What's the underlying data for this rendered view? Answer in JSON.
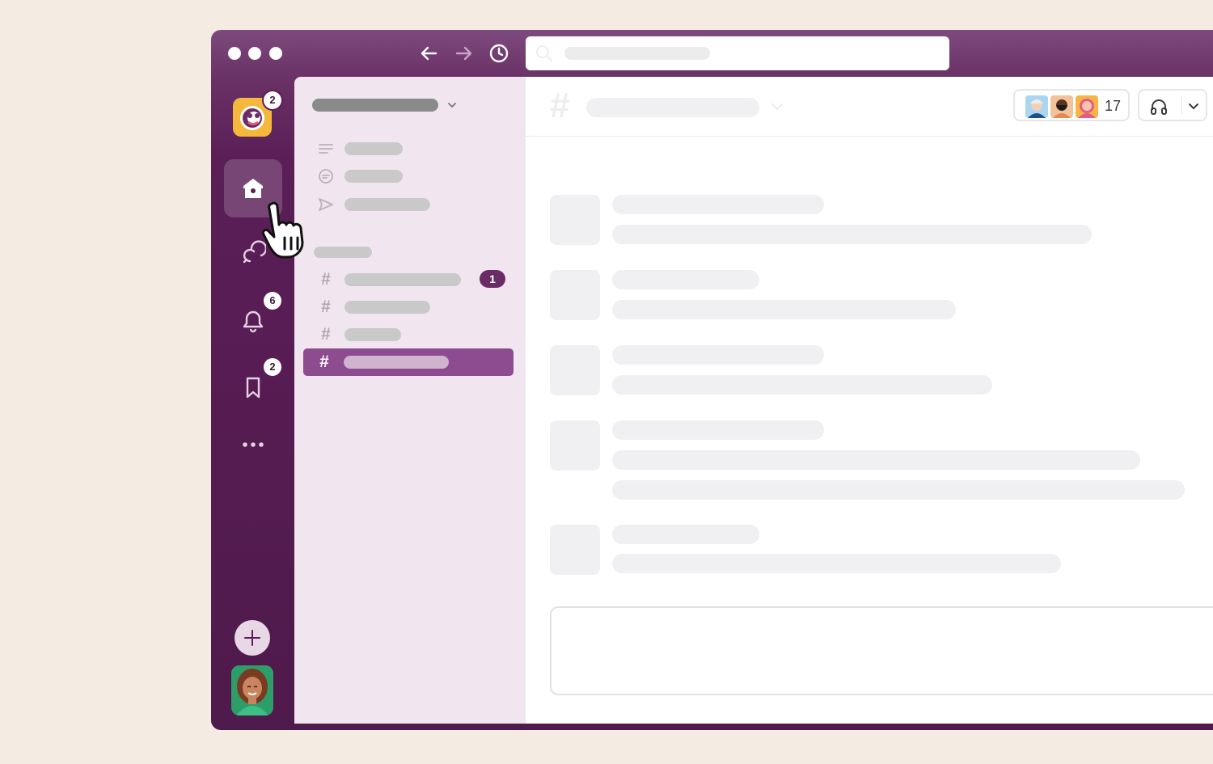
{
  "window": {
    "traffic_lights": [
      "close",
      "minimize",
      "maximize"
    ],
    "nav": [
      "arrow-left-icon",
      "arrow-right-icon",
      "history-icon"
    ],
    "search": {
      "placeholder": ""
    }
  },
  "rail": {
    "workspace": {
      "icon": "workspace-logo-icon",
      "badge": "2"
    },
    "items": [
      {
        "id": "home",
        "icon": "home-icon",
        "active": true,
        "badge": ""
      },
      {
        "id": "dms",
        "icon": "chat-bubbles-icon",
        "active": false,
        "badge": ""
      },
      {
        "id": "activity",
        "icon": "bell-icon",
        "active": false,
        "badge": "6"
      },
      {
        "id": "later",
        "icon": "bookmark-icon",
        "active": false,
        "badge": "2"
      },
      {
        "id": "more",
        "icon": "more-dots-icon",
        "active": false,
        "badge": ""
      }
    ],
    "add_button": "plus-icon",
    "user_avatar": "user-avatar"
  },
  "sidebar": {
    "channels": [
      {
        "unread": "1"
      },
      {
        "unread": ""
      },
      {
        "unread": ""
      },
      {
        "unread": "",
        "selected": true
      }
    ]
  },
  "main": {
    "header": {
      "hash_icon": "#",
      "member_count": "17",
      "huddle_icon": "headphones-icon"
    }
  },
  "colors": {
    "background": "#f4ece2",
    "rail": "#5b1e57",
    "sidebar": "#f1e6ef",
    "selected_channel": "#8e4c90",
    "unread_badge": "#6b2c66",
    "workspace_logo": "#f5b83c"
  }
}
